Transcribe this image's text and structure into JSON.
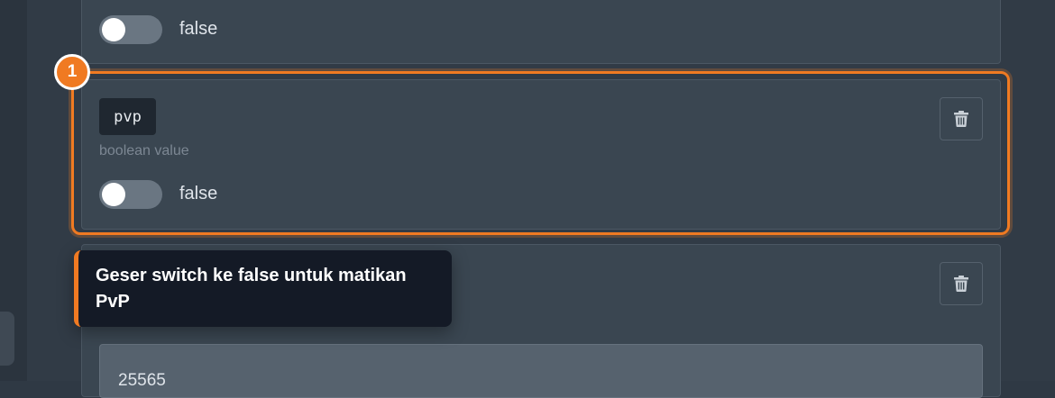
{
  "properties": [
    {
      "toggle_label": "false"
    },
    {
      "key": "pvp",
      "type_hint": "boolean value",
      "toggle_label": "false"
    },
    {
      "value": "25565"
    }
  ],
  "tutorial": {
    "step_number": "1",
    "tooltip_text": "Geser switch ke false untuk matikan PvP"
  },
  "colors": {
    "accent": "#f07a22",
    "background": "#313b46",
    "card": "#3a4651",
    "tooltip_bg": "#141a26"
  },
  "icons": {
    "delete": "trash-icon"
  }
}
